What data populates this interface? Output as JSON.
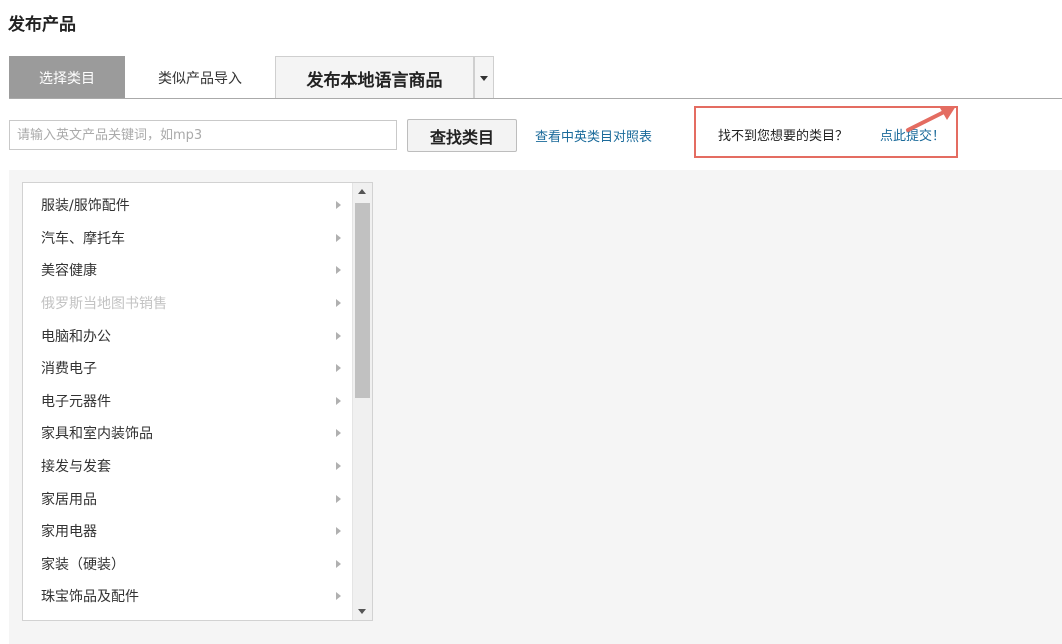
{
  "page": {
    "title": "发布产品"
  },
  "tabs": [
    {
      "label": "选择类目",
      "active": true
    },
    {
      "label": "类似产品导入",
      "active": false
    },
    {
      "label": "发布本地语言商品",
      "active": false
    }
  ],
  "search": {
    "placeholder": "请输入英文产品关键词，如mp3",
    "value": "",
    "button_label": "查找类目",
    "compare_link": "查看中英类目对照表"
  },
  "notice": {
    "text": "找不到您想要的类目？",
    "submit_link": "点此提交！"
  },
  "categories": [
    {
      "label": "服装/服饰配件",
      "disabled": false
    },
    {
      "label": "汽车、摩托车",
      "disabled": false
    },
    {
      "label": "美容健康",
      "disabled": false
    },
    {
      "label": "俄罗斯当地图书销售",
      "disabled": true
    },
    {
      "label": "电脑和办公",
      "disabled": false
    },
    {
      "label": "消费电子",
      "disabled": false
    },
    {
      "label": "电子元器件",
      "disabled": false
    },
    {
      "label": "家具和室内装饰品",
      "disabled": false
    },
    {
      "label": "接发与发套",
      "disabled": false
    },
    {
      "label": "家居用品",
      "disabled": false
    },
    {
      "label": "家用电器",
      "disabled": false
    },
    {
      "label": "家装（硬装）",
      "disabled": false
    },
    {
      "label": "珠宝饰品及配件",
      "disabled": false
    }
  ],
  "colors": {
    "active_tab": "#9b9b9b",
    "link": "#1a6a9a",
    "highlight_border": "#e46c61",
    "disabled_text": "#c3c3c3"
  },
  "icons": {
    "tab_dropdown": "caret-down-icon",
    "category_item": "chevron-right-icon",
    "annotation": "red-arrow-icon"
  }
}
